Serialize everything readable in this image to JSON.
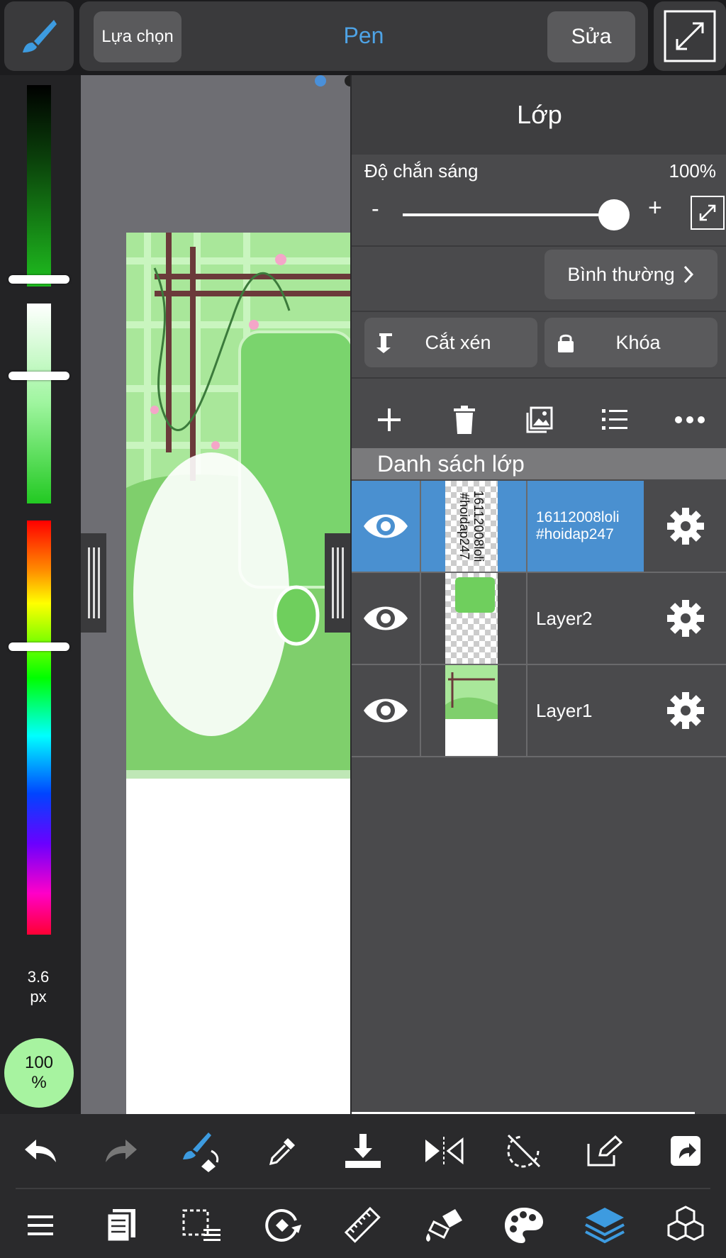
{
  "topbar": {
    "selection_label": "Lựa chọn",
    "tool_title": "Pen",
    "edit_label": "Sửa"
  },
  "colors": {
    "accent": "#4ea3e6",
    "active_layer": "#4a90d0",
    "panel_bg": "#4a4a4c"
  },
  "color_panel": {
    "brush_size": "3.6",
    "brush_unit": "px",
    "opacity_value": "100",
    "opacity_unit": "%"
  },
  "layer_panel": {
    "title": "Lớp",
    "opacity_label": "Độ chắn sáng",
    "opacity_value": "100%",
    "slider_minus": "-",
    "slider_plus": "+",
    "opacity_level": 1.0,
    "blend_mode": "Bình thường",
    "clip_label": "Cắt xén",
    "lock_label": "Khóa",
    "list_header": "Danh sách lớp",
    "layers": [
      {
        "name": "16112008loli\n#hoidap247",
        "thumb_text": "16112008loli\n#hoidap247",
        "visible": true,
        "active": true
      },
      {
        "name": "Layer2",
        "visible": true,
        "active": false
      },
      {
        "name": "Layer1",
        "visible": true,
        "active": false
      }
    ]
  },
  "icons": {
    "top": [
      "brush-icon",
      "expand-icon"
    ],
    "layer_tools": [
      "add-layer-icon",
      "delete-layer-icon",
      "image-layer-icon",
      "layer-list-icon",
      "more-icon"
    ],
    "bottom_row1": [
      "undo-icon",
      "redo-icon",
      "transform-brush-icon",
      "eyedropper-icon",
      "download-icon",
      "flip-icon",
      "rotate-reset-icon",
      "export-icon",
      "share-icon"
    ],
    "bottom_row2": [
      "menu-icon",
      "pages-icon",
      "selection-icon",
      "rotate-canvas-icon",
      "ruler-icon",
      "fill-icon",
      "palette-icon",
      "layers-icon",
      "materials-icon"
    ]
  }
}
